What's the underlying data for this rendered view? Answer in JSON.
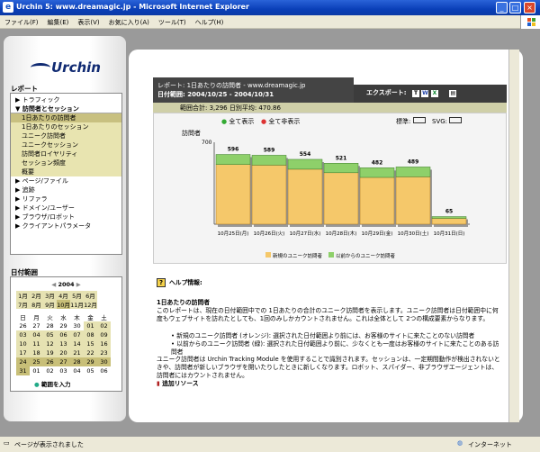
{
  "window": {
    "title": "Urchin 5: www.dreamagic.jp - Microsoft Internet Explorer",
    "min": "_",
    "max": "□",
    "close": "×",
    "icon": "e"
  },
  "menu": [
    "ファイル(F)",
    "編集(E)",
    "表示(V)",
    "お気に入り(A)",
    "ツール(T)",
    "ヘルプ(H)"
  ],
  "logo": "Urchin",
  "sidebar": {
    "reports_title": "レポート",
    "nav": [
      {
        "label": "トラフィック",
        "kind": "top"
      },
      {
        "label": "訪問者とセッション",
        "kind": "open"
      },
      {
        "label": "1日あたりの訪問者",
        "kind": "active"
      },
      {
        "label": "1日あたりのセッション",
        "kind": "sub"
      },
      {
        "label": "ユニーク訪問者",
        "kind": "sub"
      },
      {
        "label": "ユニークセッション",
        "kind": "sub"
      },
      {
        "label": "訪問者ロイヤリティ",
        "kind": "sub"
      },
      {
        "label": "セッション頻度",
        "kind": "sub"
      },
      {
        "label": "概要",
        "kind": "sub"
      },
      {
        "label": "ページ/ファイル",
        "kind": "top"
      },
      {
        "label": "追跡",
        "kind": "top"
      },
      {
        "label": "リファラ",
        "kind": "top"
      },
      {
        "label": "ドメイン/ユーザー",
        "kind": "top"
      },
      {
        "label": "ブラウザ/ロボット",
        "kind": "top"
      },
      {
        "label": "クライアントパラメータ",
        "kind": "top"
      }
    ],
    "date_title": "日付範囲",
    "year": "2004",
    "months": [
      [
        "1月",
        "2月",
        "3月",
        "4月",
        "5月",
        "6月"
      ],
      [
        "7月",
        "8月",
        "9月",
        "10月",
        "11月",
        "12月"
      ]
    ],
    "weekdays": [
      "日",
      "月",
      "火",
      "水",
      "木",
      "金",
      "土"
    ],
    "weeks": [
      [
        "26",
        "27",
        "28",
        "29",
        "30",
        "01",
        "02"
      ],
      [
        "03",
        "04",
        "05",
        "06",
        "07",
        "08",
        "09"
      ],
      [
        "10",
        "11",
        "12",
        "13",
        "14",
        "15",
        "16"
      ],
      [
        "17",
        "18",
        "19",
        "20",
        "21",
        "22",
        "23"
      ],
      [
        "24",
        "25",
        "26",
        "27",
        "28",
        "29",
        "30"
      ],
      [
        "31",
        "01",
        "02",
        "03",
        "04",
        "05",
        "06"
      ]
    ],
    "range_link": "範囲を入力"
  },
  "report": {
    "title": "レポート: 1日あたりの訪問者 - www.dreamagic.jp",
    "range": "日付範囲: 2004/10/25 - 2004/10/31",
    "export_label": "エクスポート:",
    "summary": "範囲合計: 3,296   日別平均: 470.86",
    "show_all": "全て表示",
    "hide_all": "全て非表示",
    "std_label": "標準:",
    "svg_label": "SVG:",
    "icons": [
      "text-export-icon",
      "word-export-icon",
      "excel-export-icon",
      "print-icon"
    ]
  },
  "chart_data": {
    "type": "bar",
    "stacked": true,
    "ylabel": "訪問者",
    "ylim": [
      0,
      700
    ],
    "yticks": [
      700
    ],
    "categories": [
      "10月25日(月)",
      "10月26日(火)",
      "10月27日(水)",
      "10月28日(木)",
      "10月29日(金)",
      "10月30日(土)",
      "10月31日(日)"
    ],
    "totals": [
      596,
      589,
      554,
      521,
      482,
      489,
      65
    ],
    "series": [
      {
        "name": "新規のユニーク訪問者",
        "color": "#f5c86a",
        "values": [
          510,
          505,
          470,
          440,
          400,
          405,
          50
        ]
      },
      {
        "name": "以前からのユニーク訪問者",
        "color": "#8ed06a",
        "values": [
          86,
          84,
          84,
          81,
          82,
          84,
          15
        ]
      }
    ],
    "grid": false,
    "legend": "bottom"
  },
  "help": {
    "title": "ヘルプ情報:",
    "subtitle": "1日あたりの訪問者",
    "p1": "このレポートは、現在の日付範囲中での 1日あたりの合計のユニーク訪問者を表示します。ユニーク訪問者は日付範囲中に何度もウェブサイトを訪れたとしても、1回のみしかカウントされません。これは全体として 2つの構成要素からなります。",
    "b1": "新規のユニーク訪問者 (オレンジ): 選択された日付範囲より前には、お客様のサイトに来たことのない訪問者",
    "b2": "以前からのユニーク訪問者 (緑): 選択された日付範囲より前に、少なくとも一度はお客様のサイトに来たことのある訪問者",
    "p2": "ユニーク訪問者は Urchin Tracking Module を使用することで識別されます。セッションは、一定期間動作が検出されないときや、訪問者が新しいブラウザを開いたりしたときに新しくなります。ロボット、スパイダー、非ブラウザエージェントは、訪問者にはカウントされません。",
    "more": "追加リソース"
  },
  "status": {
    "text": "ページが表示されました",
    "zone": "インターネット"
  }
}
